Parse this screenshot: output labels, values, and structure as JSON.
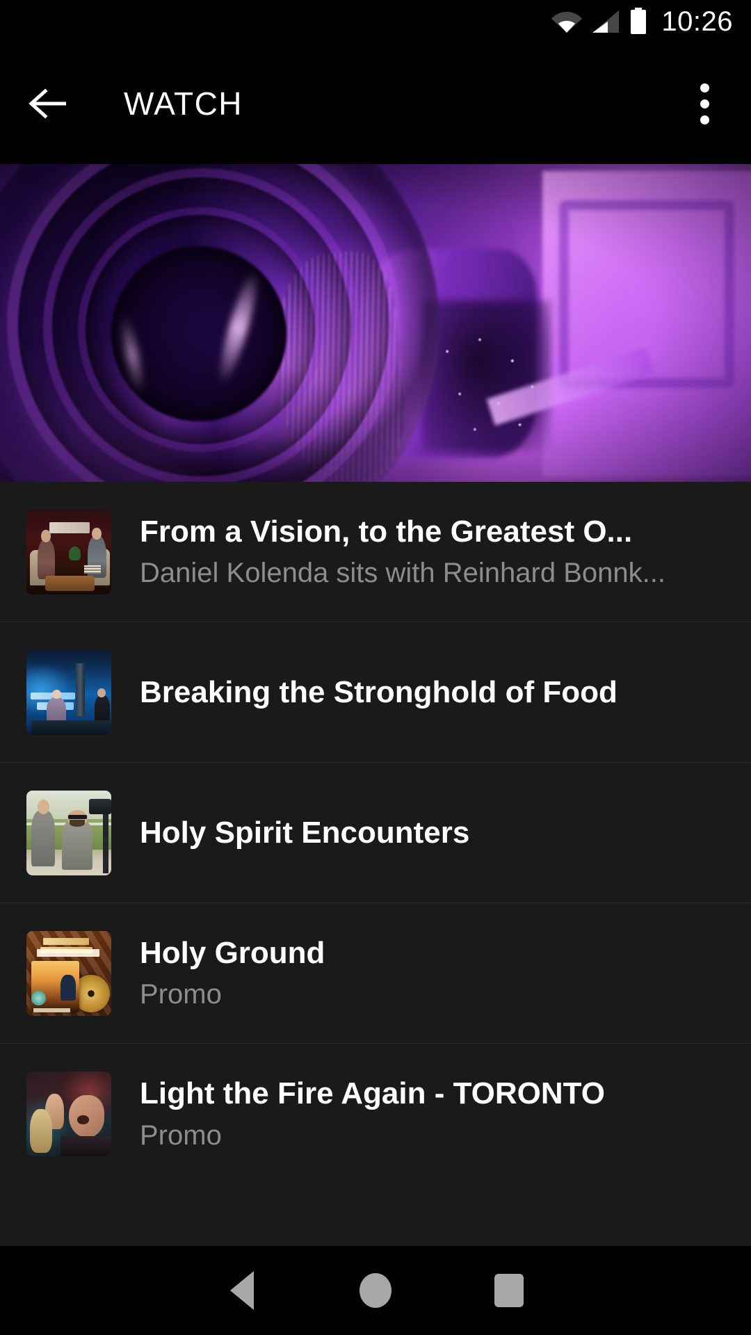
{
  "status_bar": {
    "wifi_icon": "wifi-icon",
    "signal_icon": "cellular-signal-icon",
    "battery_icon": "battery-full-icon",
    "clock": "10:26"
  },
  "app_bar": {
    "back_icon": "back-arrow-icon",
    "title": "WATCH",
    "overflow_icon": "more-vert-icon"
  },
  "hero": {
    "name": "hero-banner-image",
    "description": "Purple-tinted close-up of a cinema camera lens"
  },
  "list": {
    "items": [
      {
        "title": "From a Vision, to the Greatest O...",
        "subtitle": "Daniel Kolenda sits with Reinhard Bonnk...",
        "thumb_name": "thumbnail-cfan-interview"
      },
      {
        "title": "Breaking the Stronghold of Food",
        "subtitle": "",
        "thumb_name": "thumbnail-christ-for-all-nations-studio"
      },
      {
        "title": "Holy Spirit Encounters",
        "subtitle": "",
        "thumb_name": "thumbnail-outdoor-camera-crew"
      },
      {
        "title": "Holy Ground",
        "subtitle": "Promo",
        "thumb_name": "thumbnail-holy-ground-dvd"
      },
      {
        "title": "Light the Fire Again - TORONTO",
        "subtitle": "Promo",
        "thumb_name": "thumbnail-worship-crowd"
      }
    ]
  },
  "nav_bar": {
    "back_icon": "nav-back-icon",
    "home_icon": "nav-home-icon",
    "recents_icon": "nav-recents-icon"
  },
  "colors": {
    "app_bar_bg": "#000000",
    "list_bg": "#1a1a1a",
    "divider": "#2a2a2a",
    "title_text": "#ffffff",
    "subtitle_text": "#8d8d8d",
    "nav_icon": "#a8a8a8",
    "hero_accent": "#b44ee8"
  }
}
